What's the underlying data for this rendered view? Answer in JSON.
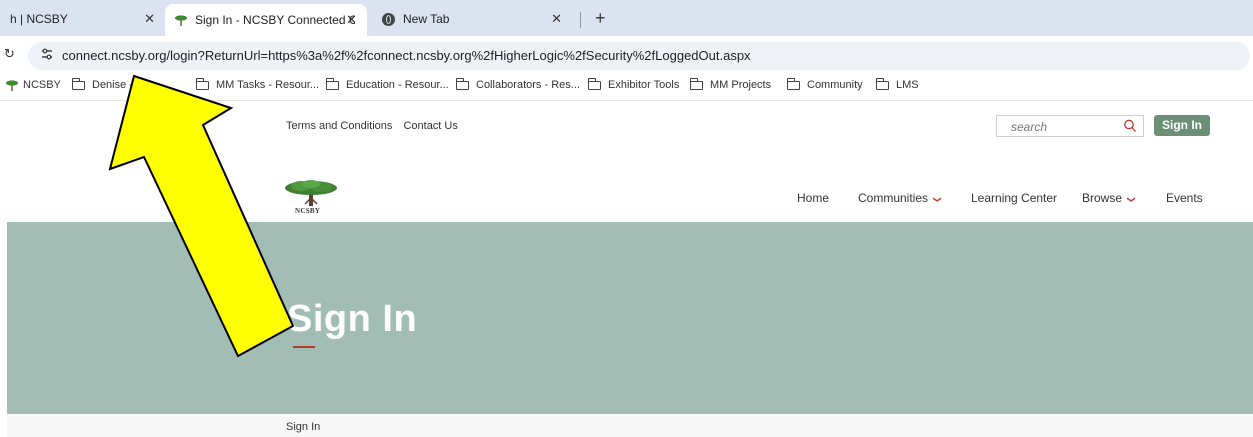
{
  "browser": {
    "tabs": [
      {
        "title": "h | NCSBY",
        "active": false
      },
      {
        "title": "Sign In - NCSBY Connected Cor",
        "active": true
      },
      {
        "title": "New Tab",
        "active": false
      }
    ],
    "new_tab_label": "+",
    "address": "connect.ncsby.org/login?ReturnUrl=https%3a%2f%2fconnect.ncsby.org%2fHigherLogic%2fSecurity%2fLoggedOut.aspx",
    "bookmarks": [
      {
        "label": "NCSBY",
        "icon": "tree-favicon"
      },
      {
        "label": "Denise -",
        "icon": "folder-icon"
      },
      {
        "label": "MM Tasks - Resour...",
        "icon": "folder-icon"
      },
      {
        "label": "Education - Resour...",
        "icon": "folder-icon"
      },
      {
        "label": "Collaborators - Res...",
        "icon": "folder-icon"
      },
      {
        "label": "Exhibitor Tools",
        "icon": "folder-icon"
      },
      {
        "label": "MM Projects",
        "icon": "folder-icon"
      },
      {
        "label": "Community",
        "icon": "folder-icon"
      },
      {
        "label": "LMS",
        "icon": "folder-icon"
      }
    ]
  },
  "site": {
    "util_links": [
      "Terms and Conditions",
      "Contact Us"
    ],
    "search_placeholder": "search",
    "signin_button": "Sign In",
    "logo_text": "NCSBY",
    "nav": [
      {
        "label": "Home",
        "dropdown": false
      },
      {
        "label": "Communities",
        "dropdown": true
      },
      {
        "label": "Learning Center",
        "dropdown": false
      },
      {
        "label": "Browse",
        "dropdown": true
      },
      {
        "label": "Events",
        "dropdown": false
      }
    ],
    "hero_title": "Sign In",
    "breadcrumb": "Sign In"
  },
  "colors": {
    "hero_bg": "#a2bdb4",
    "signin_button_bg": "#6b8f77",
    "accent_red": "#b23a2e",
    "arrow_fill": "#ffff00"
  }
}
